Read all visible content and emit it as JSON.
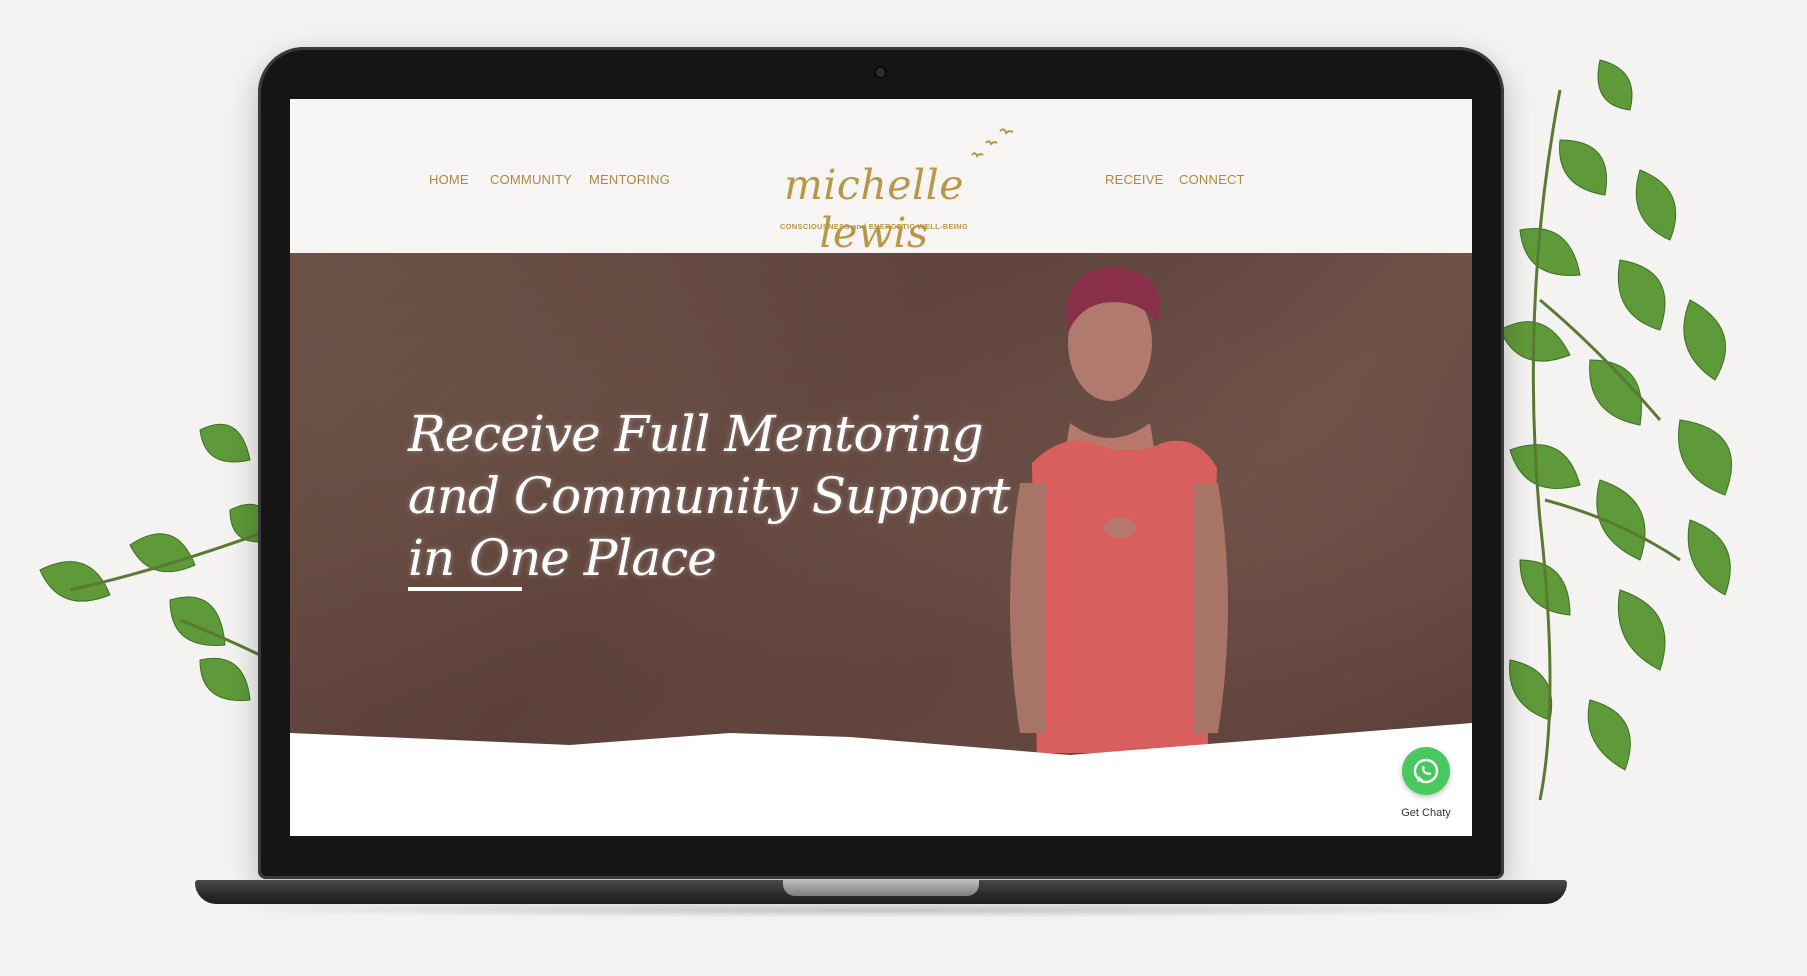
{
  "nav": {
    "left": [
      "HOME",
      "COMMUNITY",
      "MENTORING"
    ],
    "right": [
      "RECEIVE",
      "CONNECT"
    ]
  },
  "logo": {
    "name": "michelle lewis",
    "tagline": "CONSCIOUSNESS and ENERGETIC WELL-BEING",
    "icon": "birds-icon"
  },
  "hero": {
    "title": "Receive Full Mentoring and Community Support in One Place"
  },
  "chat": {
    "label": "Get Chaty",
    "icon": "whatsapp-icon"
  },
  "colors": {
    "accent": "#b89748",
    "nav": "#a98b3f",
    "chat": "#49c85f"
  }
}
